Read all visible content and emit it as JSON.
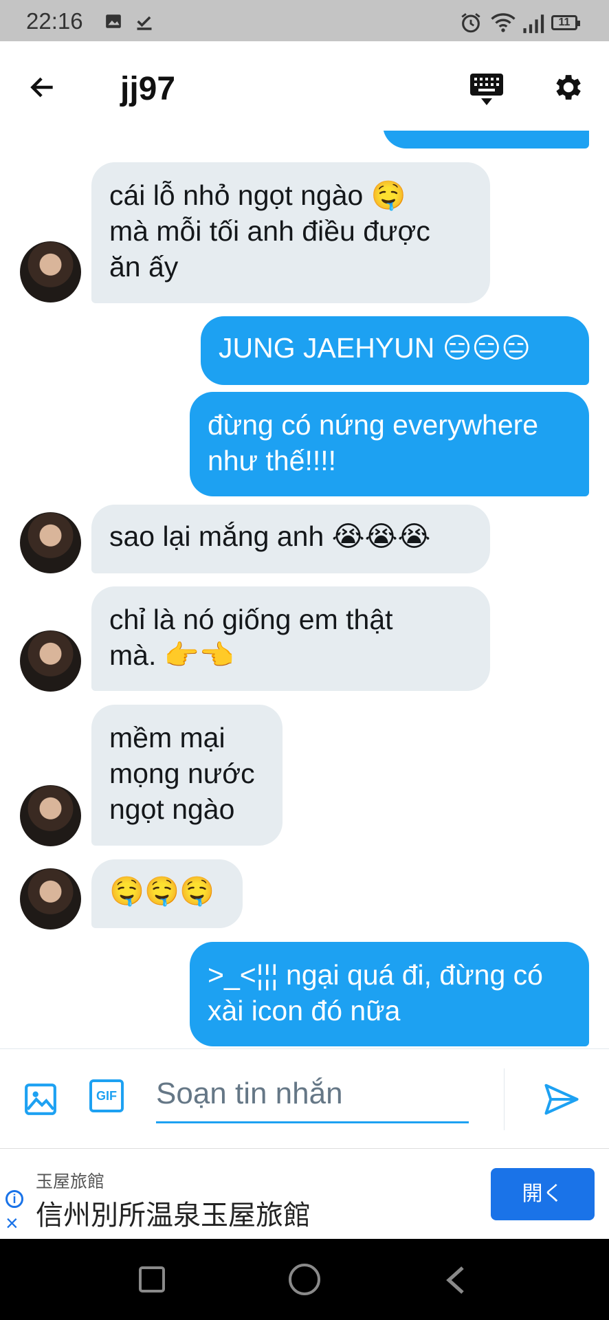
{
  "status_bar": {
    "time": "22:16",
    "battery": "11"
  },
  "header": {
    "title": "jj97"
  },
  "messages": [
    {
      "side": "in",
      "text": "cái lỗ nhỏ ngọt ngào 🤤\nmà mỗi tối anh điều được\năn ấy"
    },
    {
      "side": "out",
      "text": "JUNG JAEHYUN  😑😑😑"
    },
    {
      "side": "out",
      "text": "đừng có nứng everywhere\nnhư thế!!!!"
    },
    {
      "side": "in",
      "text": "sao lại mắng anh  😭😭😭"
    },
    {
      "side": "in",
      "text": "chỉ là nó giống em thật\nmà. 👉👈"
    },
    {
      "side": "in",
      "text": "mềm mại\nmọng nước\nngọt ngào"
    },
    {
      "side": "in",
      "text": "🤤🤤🤤"
    },
    {
      "side": "out",
      "text": ">_<¦¦¦ ngại quá đi, đừng có\nxài icon đó nữa"
    }
  ],
  "composer": {
    "placeholder": "Soạn tin nhắn",
    "gif_label": "GIF"
  },
  "ad": {
    "advertiser": "玉屋旅館",
    "headline": "信州別所温泉玉屋旅館",
    "button": "開く"
  },
  "colors": {
    "accent": "#1da1f2",
    "incoming": "#e6ecf0",
    "ad_button": "#1a73e8"
  },
  "icons": [
    "back-arrow-icon",
    "keyboard-icon",
    "gear-icon",
    "image-icon",
    "gif-icon",
    "send-icon",
    "info-icon",
    "close-icon",
    "recent-apps-icon",
    "home-icon",
    "nav-back-icon"
  ]
}
